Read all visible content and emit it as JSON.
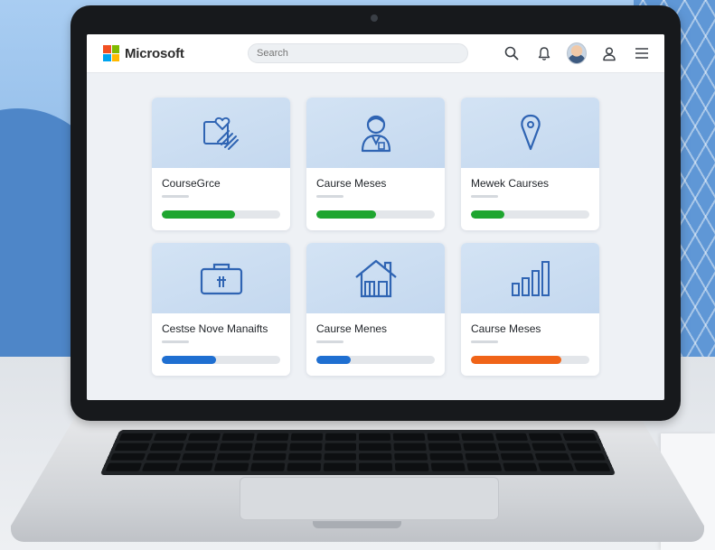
{
  "app": {
    "brand": "Microsoft"
  },
  "search": {
    "placeholder": "Search"
  },
  "header_icons": [
    "search-icon",
    "bell-icon",
    "avatar",
    "user-icon",
    "menu-icon"
  ],
  "courses": [
    {
      "title": "CourseGrce",
      "icon": "heart-hand-icon",
      "progress": 0.62,
      "color": "#1ea52f"
    },
    {
      "title": "Caurse Meses",
      "icon": "person-icon",
      "progress": 0.5,
      "color": "#1ea52f"
    },
    {
      "title": "Mewek Caurses",
      "icon": "pin-icon",
      "progress": 0.28,
      "color": "#1ea52f"
    },
    {
      "title": "Cestse Nove Manaifts",
      "icon": "briefcase-icon",
      "progress": 0.46,
      "color": "#1f6fd1"
    },
    {
      "title": "Caurse Menes",
      "icon": "house-icon",
      "progress": 0.29,
      "color": "#1f6fd1"
    },
    {
      "title": "Caurse Meses",
      "icon": "bar-chart-icon",
      "progress": 0.76,
      "color": "#f06418"
    }
  ]
}
